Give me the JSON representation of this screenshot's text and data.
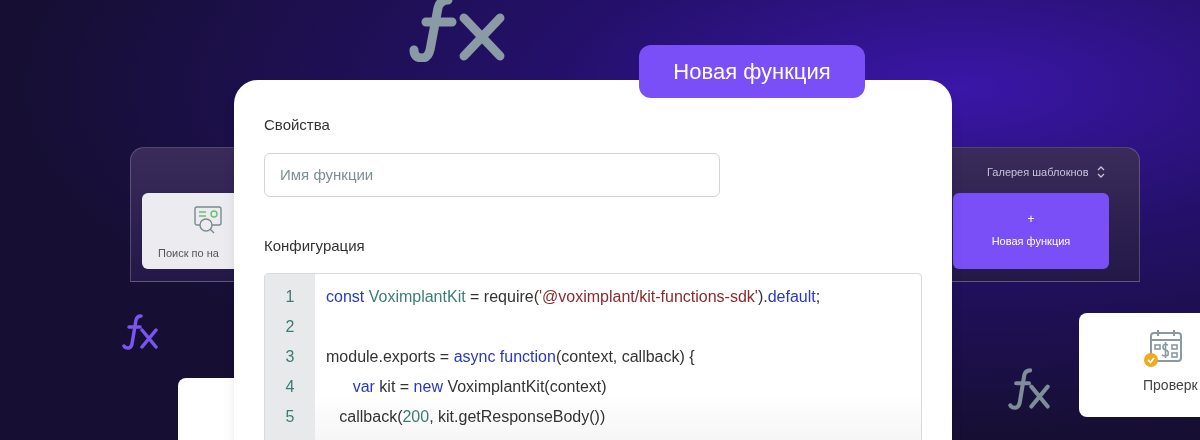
{
  "badge": {
    "label": "Новая функция"
  },
  "background_panel": {
    "gallery_label": "Галерея шаблокнов",
    "left_card": {
      "label": "Поиск по на"
    },
    "new_button": {
      "icon": "+",
      "label": "Новая функция"
    }
  },
  "form": {
    "properties_heading": "Свойства",
    "name_field": {
      "placeholder": "Имя функции"
    },
    "config_heading": "Конфигурация",
    "code_lines": [
      {
        "number": "1",
        "tokens": [
          {
            "kind": "keyword",
            "text": "const "
          },
          {
            "kind": "type",
            "text": "VoximplantKit"
          },
          {
            "kind": "plain",
            "text": " = require("
          },
          {
            "kind": "string",
            "text": "'@voximplant/kit-functions-sdk'"
          },
          {
            "kind": "plain",
            "text": ")."
          },
          {
            "kind": "keyword",
            "text": "default"
          },
          {
            "kind": "plain",
            "text": ";"
          }
        ]
      },
      {
        "number": "2"
      },
      {
        "number": "3",
        "tokens": [
          {
            "kind": "plain",
            "text": "module.exports = "
          },
          {
            "kind": "keyword",
            "text": "async function"
          },
          {
            "kind": "plain",
            "text": "(context, callback) {"
          }
        ]
      },
      {
        "number": "4",
        "tokens": [
          {
            "kind": "keyword",
            "text": "      var"
          },
          {
            "kind": "plain",
            "text": " kit = "
          },
          {
            "kind": "keyword",
            "text": "new"
          },
          {
            "kind": "plain",
            "text": " VoximplantKit(context)"
          }
        ]
      },
      {
        "number": "5",
        "tokens": [
          {
            "kind": "plain",
            "text": "   callback("
          },
          {
            "kind": "number",
            "text": "200"
          },
          {
            "kind": "plain",
            "text": ", kit.getResponseBody())"
          }
        ]
      }
    ]
  },
  "side_card": {
    "label": "Проверк"
  }
}
